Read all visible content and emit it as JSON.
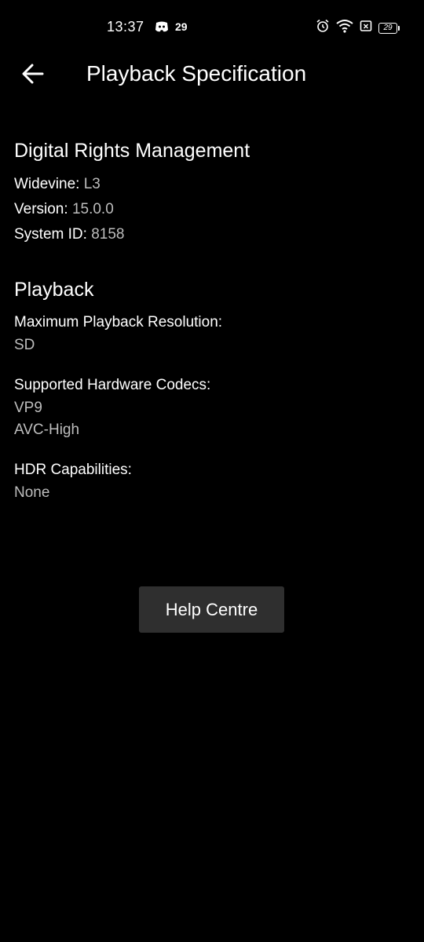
{
  "status_bar": {
    "time": "13:37",
    "notification_count": "29",
    "battery_level": "29",
    "icons": [
      "discord-icon",
      "alarm-icon",
      "wifi-icon",
      "sim-icon",
      "battery-icon"
    ]
  },
  "header": {
    "title": "Playback Specification",
    "back_icon": "arrow-left-icon"
  },
  "drm": {
    "title": "Digital Rights Management",
    "widevine_label": "Widevine:",
    "widevine_value": "L3",
    "version_label": "Version:",
    "version_value": "15.0.0",
    "system_id_label": "System ID:",
    "system_id_value": "8158"
  },
  "playback": {
    "title": "Playback",
    "max_resolution_label": "Maximum Playback Resolution:",
    "max_resolution_value": "SD",
    "codecs_label": "Supported Hardware Codecs:",
    "codecs": [
      "VP9",
      "AVC-High"
    ],
    "hdr_label": "HDR Capabilities:",
    "hdr_value": "None"
  },
  "help_button": {
    "label": "Help Centre"
  },
  "colors": {
    "background": "#000000",
    "text_primary": "#ffffff",
    "text_secondary": "#bdbdbd",
    "button_bg": "#2f2f2f"
  }
}
